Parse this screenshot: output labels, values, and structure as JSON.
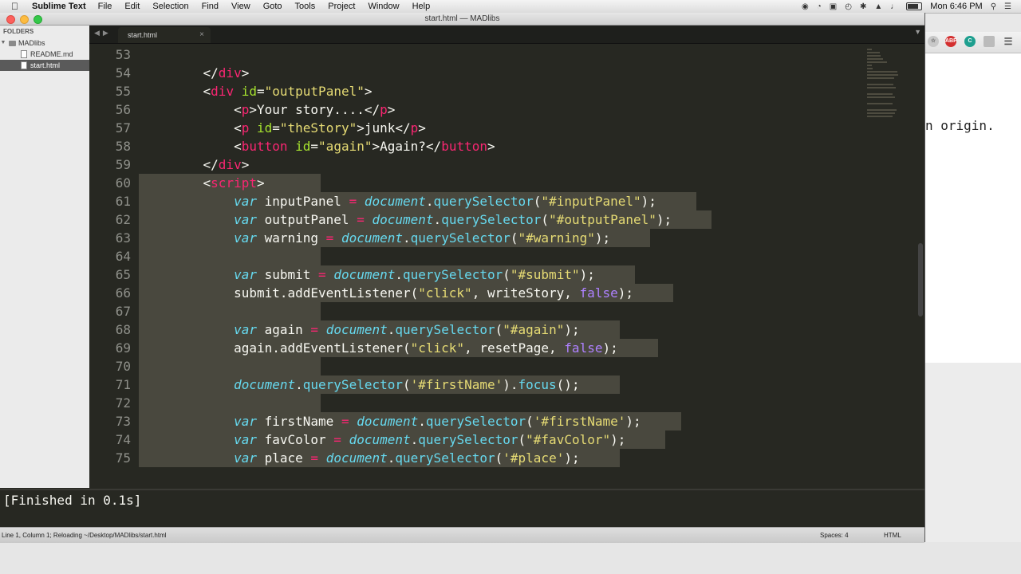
{
  "menubar": {
    "app": "Sublime Text",
    "items": [
      "File",
      "Edit",
      "Selection",
      "Find",
      "View",
      "Goto",
      "Tools",
      "Project",
      "Window",
      "Help"
    ],
    "clock": "Mon 6:46 PM"
  },
  "window": {
    "title": "start.html — MADlibs"
  },
  "sidebar": {
    "header": "FOLDERS",
    "folder": "MADlibs",
    "files": [
      "README.md",
      "start.html"
    ],
    "selected": "start.html"
  },
  "tab": {
    "label": "start.html"
  },
  "editor": {
    "first_line": 53,
    "selected_from": 60,
    "lines": [
      [],
      [
        [
          "txt",
          "    </"
        ],
        [
          "tag",
          "div"
        ],
        [
          "txt",
          ">"
        ]
      ],
      [
        [
          "txt",
          "    <"
        ],
        [
          "tag",
          "div"
        ],
        [
          "txt",
          " "
        ],
        [
          "attr",
          "id"
        ],
        [
          "txt",
          "="
        ],
        [
          "str",
          "\"outputPanel\""
        ],
        [
          "txt",
          ">"
        ]
      ],
      [
        [
          "txt",
          "        <"
        ],
        [
          "tag",
          "p"
        ],
        [
          "txt",
          ">Your story....</"
        ],
        [
          "tag",
          "p"
        ],
        [
          "txt",
          ">"
        ]
      ],
      [
        [
          "txt",
          "        <"
        ],
        [
          "tag",
          "p"
        ],
        [
          "txt",
          " "
        ],
        [
          "attr",
          "id"
        ],
        [
          "txt",
          "="
        ],
        [
          "str",
          "\"theStory\""
        ],
        [
          "txt",
          ">junk</"
        ],
        [
          "tag",
          "p"
        ],
        [
          "txt",
          ">"
        ]
      ],
      [
        [
          "txt",
          "        <"
        ],
        [
          "tag",
          "button"
        ],
        [
          "txt",
          " "
        ],
        [
          "attr",
          "id"
        ],
        [
          "txt",
          "="
        ],
        [
          "str",
          "\"again\""
        ],
        [
          "txt",
          ">Again?</"
        ],
        [
          "tag",
          "button"
        ],
        [
          "txt",
          ">"
        ]
      ],
      [
        [
          "txt",
          "    </"
        ],
        [
          "tag",
          "div"
        ],
        [
          "txt",
          ">"
        ]
      ],
      [
        [
          "txt",
          "    <"
        ],
        [
          "tag",
          "script"
        ],
        [
          "txt",
          ">"
        ]
      ],
      [
        [
          "txt",
          "        "
        ],
        [
          "kw",
          "var"
        ],
        [
          "txt",
          " inputPanel "
        ],
        [
          "op",
          "="
        ],
        [
          "txt",
          " "
        ],
        [
          "kw",
          "document"
        ],
        [
          "txt",
          "."
        ],
        [
          "fn",
          "querySelector"
        ],
        [
          "txt",
          "("
        ],
        [
          "str",
          "\"#inputPanel\""
        ],
        [
          "txt",
          ");"
        ]
      ],
      [
        [
          "txt",
          "        "
        ],
        [
          "kw",
          "var"
        ],
        [
          "txt",
          " outputPanel "
        ],
        [
          "op",
          "="
        ],
        [
          "txt",
          " "
        ],
        [
          "kw",
          "document"
        ],
        [
          "txt",
          "."
        ],
        [
          "fn",
          "querySelector"
        ],
        [
          "txt",
          "("
        ],
        [
          "str",
          "\"#outputPanel\""
        ],
        [
          "txt",
          ");"
        ]
      ],
      [
        [
          "txt",
          "        "
        ],
        [
          "kw",
          "var"
        ],
        [
          "txt",
          " warning "
        ],
        [
          "op",
          "="
        ],
        [
          "txt",
          " "
        ],
        [
          "kw",
          "document"
        ],
        [
          "txt",
          "."
        ],
        [
          "fn",
          "querySelector"
        ],
        [
          "txt",
          "("
        ],
        [
          "str",
          "\"#warning\""
        ],
        [
          "txt",
          ");"
        ]
      ],
      [],
      [
        [
          "txt",
          "        "
        ],
        [
          "kw",
          "var"
        ],
        [
          "txt",
          " submit "
        ],
        [
          "op",
          "="
        ],
        [
          "txt",
          " "
        ],
        [
          "kw",
          "document"
        ],
        [
          "txt",
          "."
        ],
        [
          "fn",
          "querySelector"
        ],
        [
          "txt",
          "("
        ],
        [
          "str",
          "\"#submit\""
        ],
        [
          "txt",
          ");"
        ]
      ],
      [
        [
          "txt",
          "        submit.addEventListener("
        ],
        [
          "str",
          "\"click\""
        ],
        [
          "txt",
          ", writeStory, "
        ],
        [
          "bool",
          "false"
        ],
        [
          "txt",
          ");"
        ]
      ],
      [],
      [
        [
          "txt",
          "        "
        ],
        [
          "kw",
          "var"
        ],
        [
          "txt",
          " again "
        ],
        [
          "op",
          "="
        ],
        [
          "txt",
          " "
        ],
        [
          "kw",
          "document"
        ],
        [
          "txt",
          "."
        ],
        [
          "fn",
          "querySelector"
        ],
        [
          "txt",
          "("
        ],
        [
          "str",
          "\"#again\""
        ],
        [
          "txt",
          ");"
        ]
      ],
      [
        [
          "txt",
          "        again.addEventListener("
        ],
        [
          "str",
          "\"click\""
        ],
        [
          "txt",
          ", resetPage, "
        ],
        [
          "bool",
          "false"
        ],
        [
          "txt",
          ");"
        ]
      ],
      [],
      [
        [
          "txt",
          "        "
        ],
        [
          "kw",
          "document"
        ],
        [
          "txt",
          "."
        ],
        [
          "fn",
          "querySelector"
        ],
        [
          "txt",
          "("
        ],
        [
          "str",
          "'#firstName'"
        ],
        [
          "txt",
          ")."
        ],
        [
          "fn",
          "focus"
        ],
        [
          "txt",
          "();"
        ]
      ],
      [],
      [
        [
          "txt",
          "        "
        ],
        [
          "kw",
          "var"
        ],
        [
          "txt",
          " firstName "
        ],
        [
          "op",
          "="
        ],
        [
          "txt",
          " "
        ],
        [
          "kw",
          "document"
        ],
        [
          "txt",
          "."
        ],
        [
          "fn",
          "querySelector"
        ],
        [
          "txt",
          "("
        ],
        [
          "str",
          "'#firstName'"
        ],
        [
          "txt",
          ");"
        ]
      ],
      [
        [
          "txt",
          "        "
        ],
        [
          "kw",
          "var"
        ],
        [
          "txt",
          " favColor "
        ],
        [
          "op",
          "="
        ],
        [
          "txt",
          " "
        ],
        [
          "kw",
          "document"
        ],
        [
          "txt",
          "."
        ],
        [
          "fn",
          "querySelector"
        ],
        [
          "txt",
          "("
        ],
        [
          "str",
          "\"#favColor\""
        ],
        [
          "txt",
          ");"
        ]
      ],
      [
        [
          "txt",
          "        "
        ],
        [
          "kw",
          "var"
        ],
        [
          "txt",
          " place "
        ],
        [
          "op",
          "="
        ],
        [
          "txt",
          " "
        ],
        [
          "kw",
          "document"
        ],
        [
          "txt",
          "."
        ],
        [
          "fn",
          "querySelector"
        ],
        [
          "txt",
          "("
        ],
        [
          "str",
          "'#place'"
        ],
        [
          "txt",
          ");"
        ]
      ]
    ]
  },
  "output": {
    "text": "[Finished in 0.1s]"
  },
  "status": {
    "left": "Line 1, Column 1; Reloading ~/Desktop/MADlibs/start.html",
    "spaces": "Spaces: 4",
    "syntax": "HTML"
  },
  "browser": {
    "visible_text": "n origin."
  },
  "colors": {
    "editor_bg": "#272822",
    "selection": "#49483e",
    "tag": "#f92672",
    "attr": "#a6e22e",
    "string": "#e6db74",
    "keyword": "#66d9ef",
    "boolean": "#ae81ff"
  }
}
